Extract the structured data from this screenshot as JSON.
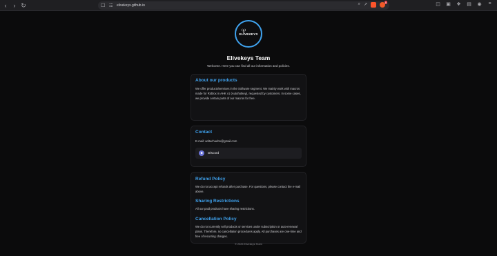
{
  "browser": {
    "url": "elivekeys.github.io",
    "extension_badge": "8"
  },
  "page": {
    "logo_text": "ELIVEKEYS",
    "title": "Elivekeys Team",
    "subtitle": "Welcome. Here you can find all our information and policies."
  },
  "about": {
    "heading": "About our products",
    "body": "We offer products/services in the Software segment. We mainly work with macros made for Roblox in AHK v1 (Autohotkey), requested by customers. In some cases, we provide certain parts of our macros for free."
  },
  "contact": {
    "heading": "Contact",
    "email": "E-mail: aoltuchuebn@gmail.com",
    "discord_label": "Discord"
  },
  "policies": {
    "refund_heading": "Refund Policy",
    "refund_body": "We do not accept refunds after purchase. For questions, please contact the e-mail above.",
    "sharing_heading": "Sharing Restrictions",
    "sharing_body": "All our paid products have sharing restrictions.",
    "cancel_heading": "Cancellation Policy",
    "cancel_body": "We do not currently sell products or services under subscription or auto-renewal plans. Therefore, no cancellation procedures apply. All purchases are one-time and free of recurring charges."
  },
  "footer": "© 2025 Elivekeys Team",
  "colors": {
    "accent": "#3fa2ee",
    "background": "#0b0b0c",
    "card": "#121214",
    "discord": "#6b74d9"
  }
}
